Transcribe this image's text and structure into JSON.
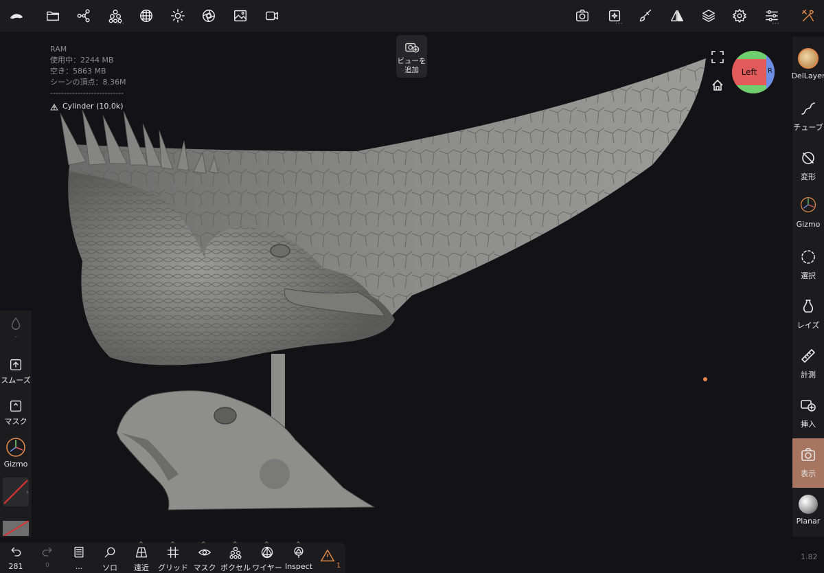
{
  "top_toolbar": {
    "left_icons": [
      "nomad-logo-icon",
      "folder-icon",
      "share-graph-icon",
      "voxel-icon",
      "sphere-wire-icon",
      "sun-icon",
      "aperture-icon",
      "image-icon",
      "video-icon"
    ],
    "right_icons": [
      "camera-icon",
      "sparkle-icon",
      "paintbrush-icon",
      "mirror-icon",
      "layers-icon",
      "gear-icon",
      "sliders-icon",
      "tools-icon"
    ],
    "accent": "#e0884a"
  },
  "stats": {
    "title": "RAM",
    "used": "使用中：2244 MB",
    "free": "空き：5863 MB",
    "vertices": "シーンの頂点：8.36M",
    "divider": "---------------------------",
    "object": "Cylinder (10.0k)"
  },
  "add_view": {
    "line1": "ビューを",
    "line2": "追加"
  },
  "view_cube": {
    "face": "Left",
    "side": "R"
  },
  "right_panel": {
    "items": [
      {
        "label": "DelLayer",
        "icon": "brush-tool-icon"
      },
      {
        "label": "チューブ",
        "icon": "tube-icon"
      },
      {
        "label": "変形",
        "icon": "transform-icon"
      },
      {
        "label": "Gizmo",
        "icon": "gizmo-icon"
      },
      {
        "label": "選択",
        "icon": "select-icon"
      },
      {
        "label": "レイズ",
        "icon": "lathe-icon"
      },
      {
        "label": "計測",
        "icon": "ruler-icon"
      },
      {
        "label": "挿入",
        "icon": "insert-icon"
      },
      {
        "label": "表示",
        "icon": "view-camera-icon",
        "active": true
      },
      {
        "label": "Planar",
        "icon": "planar-icon"
      }
    ],
    "active_color": "#a87660"
  },
  "left_panel": {
    "dash": "-",
    "smooth": "スムーズ",
    "mask": "マスク",
    "gizmo": "Gizmo"
  },
  "bottom_bar": {
    "undo_count": "281",
    "redo_count": "0",
    "items": [
      {
        "label": "...",
        "icon": "book-icon"
      },
      {
        "label": "ソロ",
        "icon": "search-icon"
      },
      {
        "label": "遠近",
        "icon": "perspective-icon"
      },
      {
        "label": "グリッド",
        "icon": "grid-icon"
      },
      {
        "label": "マスク",
        "icon": "eye-icon"
      },
      {
        "label": "ボクセル",
        "icon": "voxel-icon"
      },
      {
        "label": "ワイヤー",
        "icon": "wireframe-icon"
      },
      {
        "label": "Inspect",
        "icon": "inspect-icon"
      }
    ],
    "warning_count": "1"
  },
  "version": "1.82"
}
